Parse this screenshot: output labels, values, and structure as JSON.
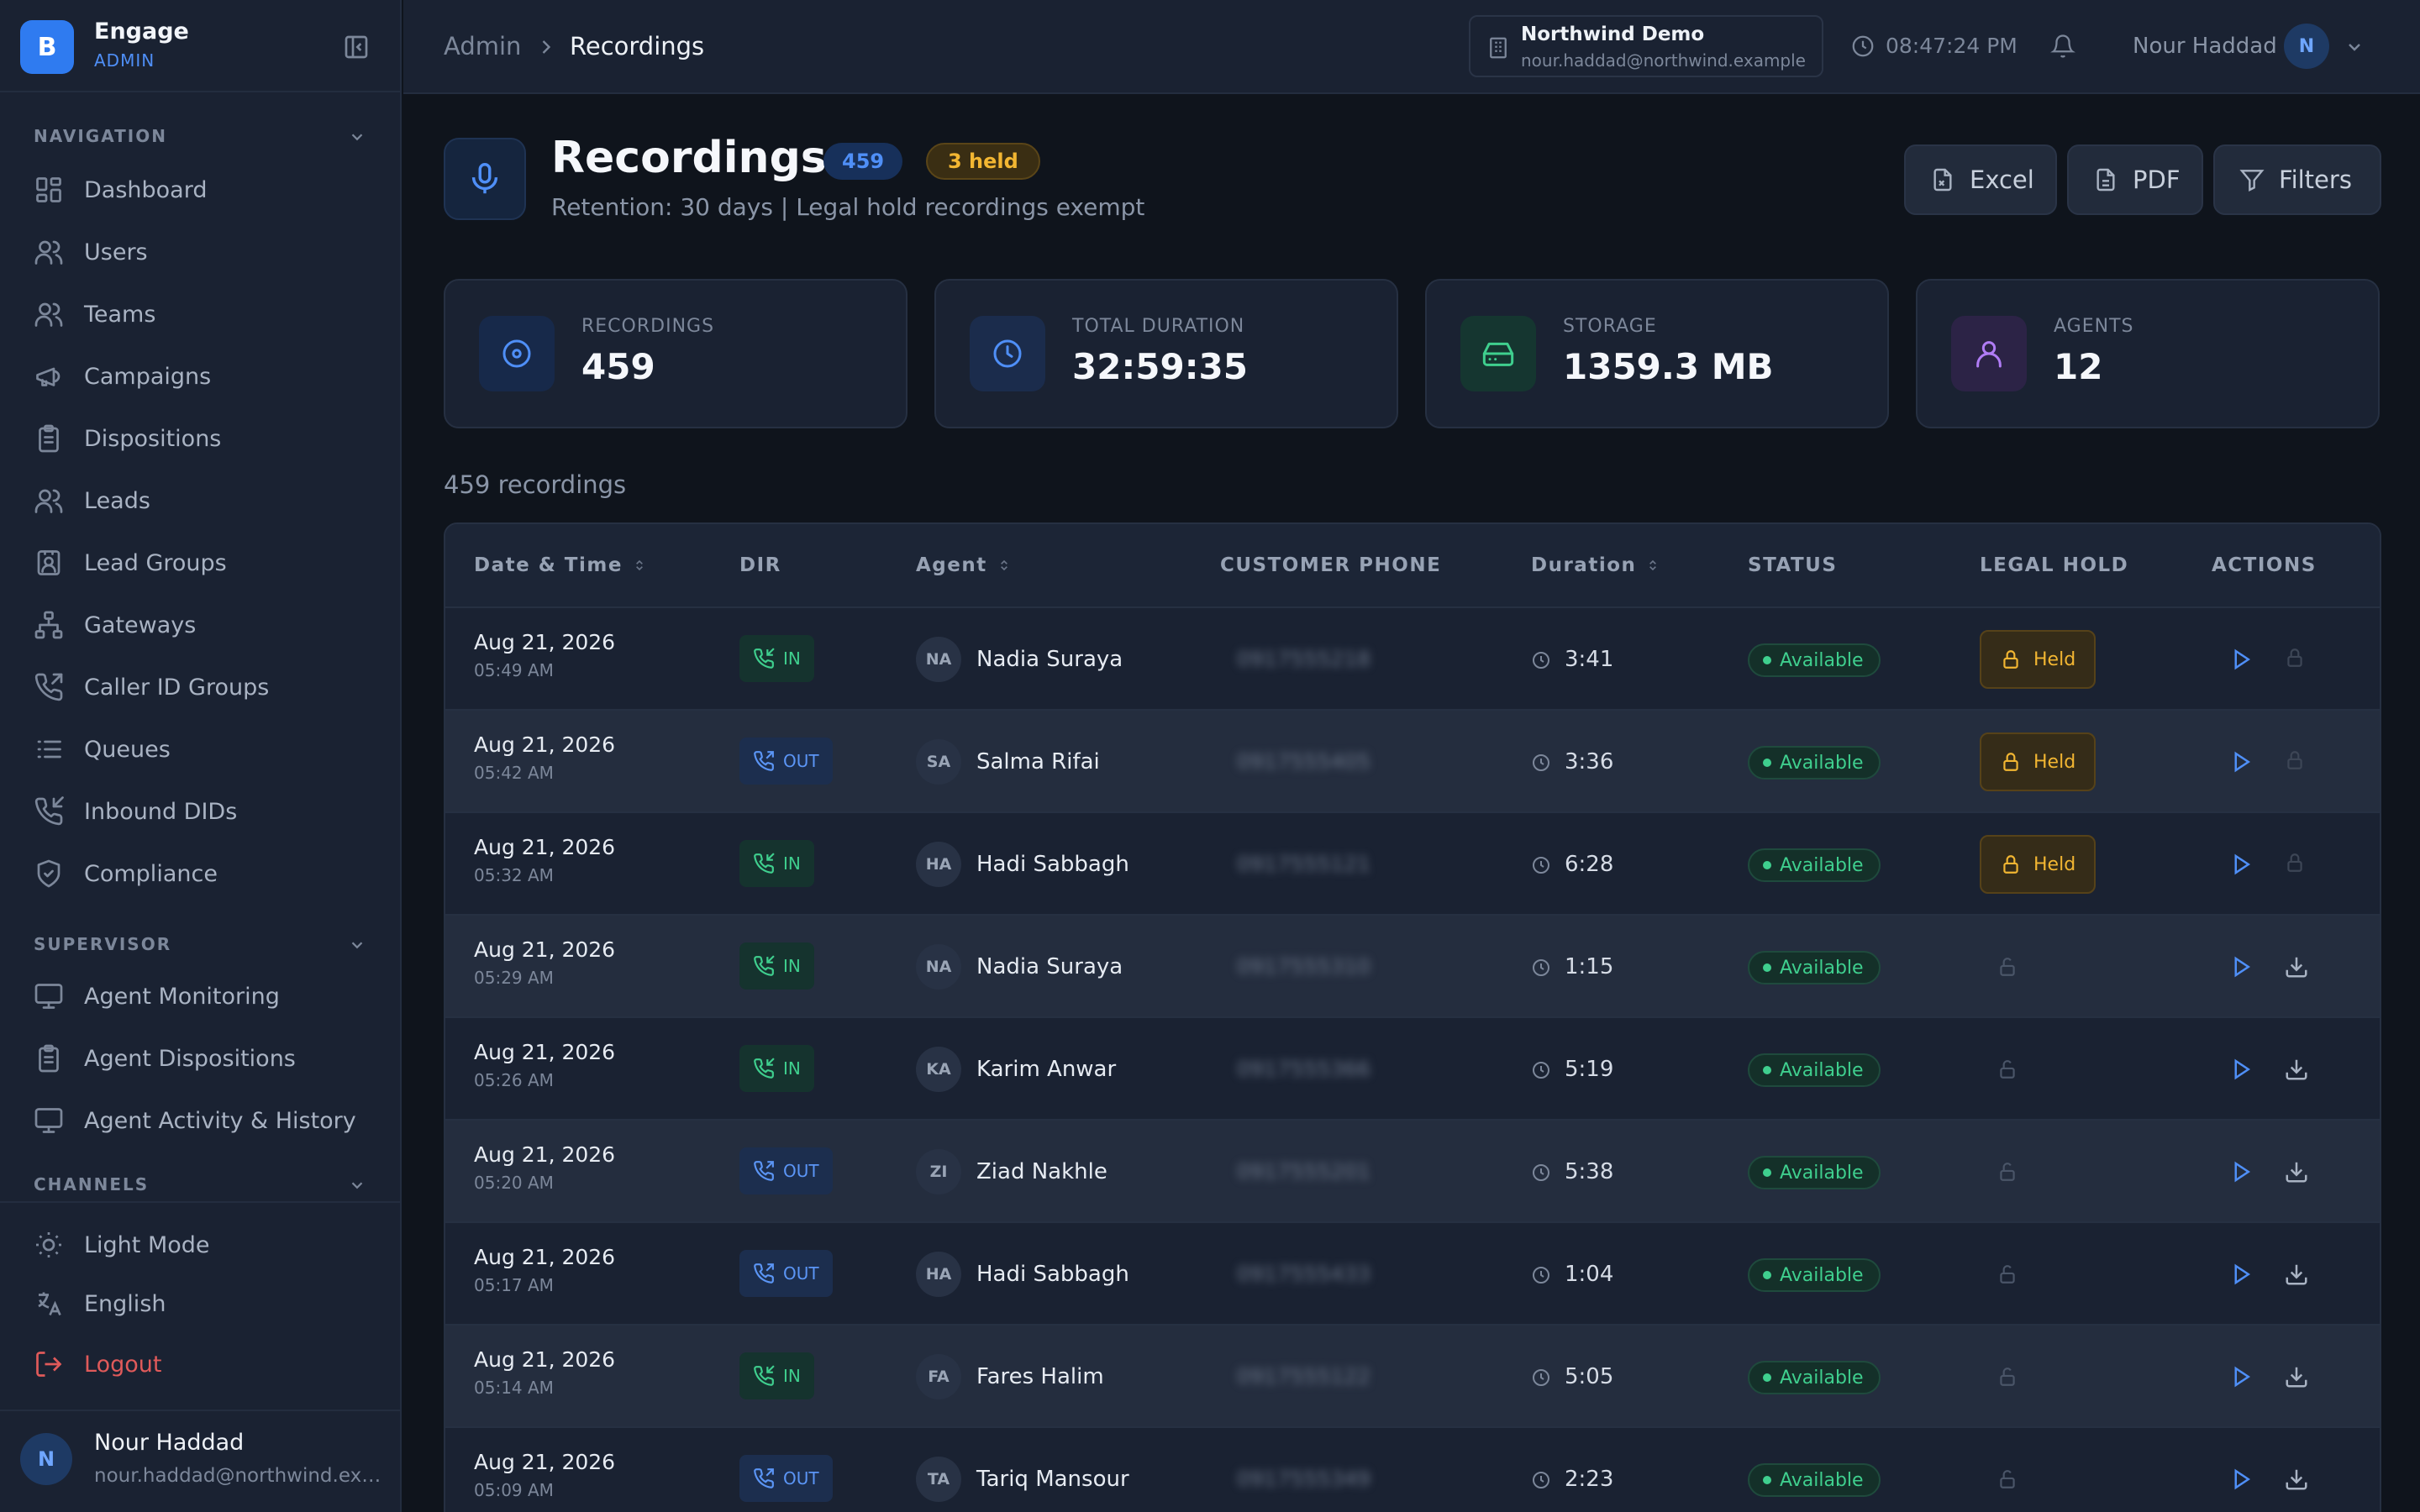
{
  "app": {
    "name": "Engage",
    "role": "ADMIN",
    "logo_letter": "B"
  },
  "sidebar": {
    "sections": [
      {
        "title": "NAVIGATION",
        "items": [
          {
            "label": "Dashboard",
            "icon": "grid-icon"
          },
          {
            "label": "Users",
            "icon": "users-icon"
          },
          {
            "label": "Teams",
            "icon": "team-icon"
          },
          {
            "label": "Campaigns",
            "icon": "megaphone-icon"
          },
          {
            "label": "Dispositions",
            "icon": "clipboard-icon"
          },
          {
            "label": "Leads",
            "icon": "leads-icon"
          },
          {
            "label": "Lead Groups",
            "icon": "contact-card-icon"
          },
          {
            "label": "Gateways",
            "icon": "network-icon"
          },
          {
            "label": "Caller ID Groups",
            "icon": "phone-outgoing-icon"
          },
          {
            "label": "Queues",
            "icon": "list-icon"
          },
          {
            "label": "Inbound DIDs",
            "icon": "phone-incoming-icon"
          },
          {
            "label": "Compliance",
            "icon": "shield-icon"
          }
        ]
      },
      {
        "title": "SUPERVISOR",
        "items": [
          {
            "label": "Agent Monitoring",
            "icon": "monitor-icon"
          },
          {
            "label": "Agent Dispositions",
            "icon": "clipboard-icon"
          },
          {
            "label": "Agent Activity & History",
            "icon": "monitor-icon"
          }
        ]
      },
      {
        "title": "CHANNELS",
        "items": []
      }
    ],
    "footer": {
      "light_mode": "Light Mode",
      "language": "English",
      "logout": "Logout"
    },
    "user": {
      "initial": "N",
      "name": "Nour Haddad",
      "email": "nour.haddad@northwind.example"
    }
  },
  "topbar": {
    "breadcrumb": [
      "Admin",
      "Recordings"
    ],
    "tenant": {
      "name": "Northwind Demo",
      "email": "nour.haddad@northwind.example"
    },
    "clock": "08:47:24 PM",
    "user_name": "Nour Haddad",
    "user_initial": "N"
  },
  "header": {
    "title": "Recordings",
    "count_badge": "459",
    "held_badge": "3 held",
    "subtitle": "Retention: 30 days | Legal hold recordings exempt",
    "buttons": {
      "excel": "Excel",
      "pdf": "PDF",
      "filters": "Filters"
    }
  },
  "stats": [
    {
      "label": "RECORDINGS",
      "value": "459",
      "icon": "disc-icon",
      "color": "#4f8ff7",
      "bg": "#17294a"
    },
    {
      "label": "TOTAL DURATION",
      "value": "32:59:35",
      "icon": "clock-icon",
      "color": "#4f8ff7",
      "bg": "#1b2c4c"
    },
    {
      "label": "STORAGE",
      "value": "1359.3 MB",
      "icon": "hard-drive-icon",
      "color": "#3fcf8e",
      "bg": "#153630"
    },
    {
      "label": "AGENTS",
      "value": "12",
      "icon": "user-icon",
      "color": "#b07cf5",
      "bg": "#2c2346"
    }
  ],
  "table": {
    "summary": "459 recordings",
    "columns": [
      "Date & Time",
      "DIR",
      "Agent",
      "CUSTOMER PHONE",
      "Duration",
      "STATUS",
      "LEGAL HOLD",
      "ACTIONS"
    ],
    "rows": [
      {
        "date": "Aug 21, 2026",
        "time": "05:49 AM",
        "dir": "IN",
        "initials": "NA",
        "agent": "Nadia Suraya",
        "phone": "0917555218",
        "duration": "3:41",
        "status": "Available",
        "held": true,
        "held_label": "Held"
      },
      {
        "date": "Aug 21, 2026",
        "time": "05:42 AM",
        "dir": "OUT",
        "initials": "SA",
        "agent": "Salma Rifai",
        "phone": "0917555405",
        "duration": "3:36",
        "status": "Available",
        "held": true,
        "held_label": "Held"
      },
      {
        "date": "Aug 21, 2026",
        "time": "05:32 AM",
        "dir": "IN",
        "initials": "HA",
        "agent": "Hadi Sabbagh",
        "phone": "0917555121",
        "duration": "6:28",
        "status": "Available",
        "held": true,
        "held_label": "Held"
      },
      {
        "date": "Aug 21, 2026",
        "time": "05:29 AM",
        "dir": "IN",
        "initials": "NA",
        "agent": "Nadia Suraya",
        "phone": "0917555310",
        "duration": "1:15",
        "status": "Available",
        "held": false,
        "held_label": ""
      },
      {
        "date": "Aug 21, 2026",
        "time": "05:26 AM",
        "dir": "IN",
        "initials": "KA",
        "agent": "Karim Anwar",
        "phone": "0917555366",
        "duration": "5:19",
        "status": "Available",
        "held": false,
        "held_label": ""
      },
      {
        "date": "Aug 21, 2026",
        "time": "05:20 AM",
        "dir": "OUT",
        "initials": "ZI",
        "agent": "Ziad Nakhle",
        "phone": "0917555201",
        "duration": "5:38",
        "status": "Available",
        "held": false,
        "held_label": ""
      },
      {
        "date": "Aug 21, 2026",
        "time": "05:17 AM",
        "dir": "OUT",
        "initials": "HA",
        "agent": "Hadi Sabbagh",
        "phone": "0917555433",
        "duration": "1:04",
        "status": "Available",
        "held": false,
        "held_label": ""
      },
      {
        "date": "Aug 21, 2026",
        "time": "05:14 AM",
        "dir": "IN",
        "initials": "FA",
        "agent": "Fares Halim",
        "phone": "0917555122",
        "duration": "5:05",
        "status": "Available",
        "held": false,
        "held_label": ""
      },
      {
        "date": "Aug 21, 2026",
        "time": "05:09 AM",
        "dir": "OUT",
        "initials": "TA",
        "agent": "Tariq Mansour",
        "phone": "0917555349",
        "duration": "2:23",
        "status": "Available",
        "held": false,
        "held_label": ""
      }
    ]
  }
}
